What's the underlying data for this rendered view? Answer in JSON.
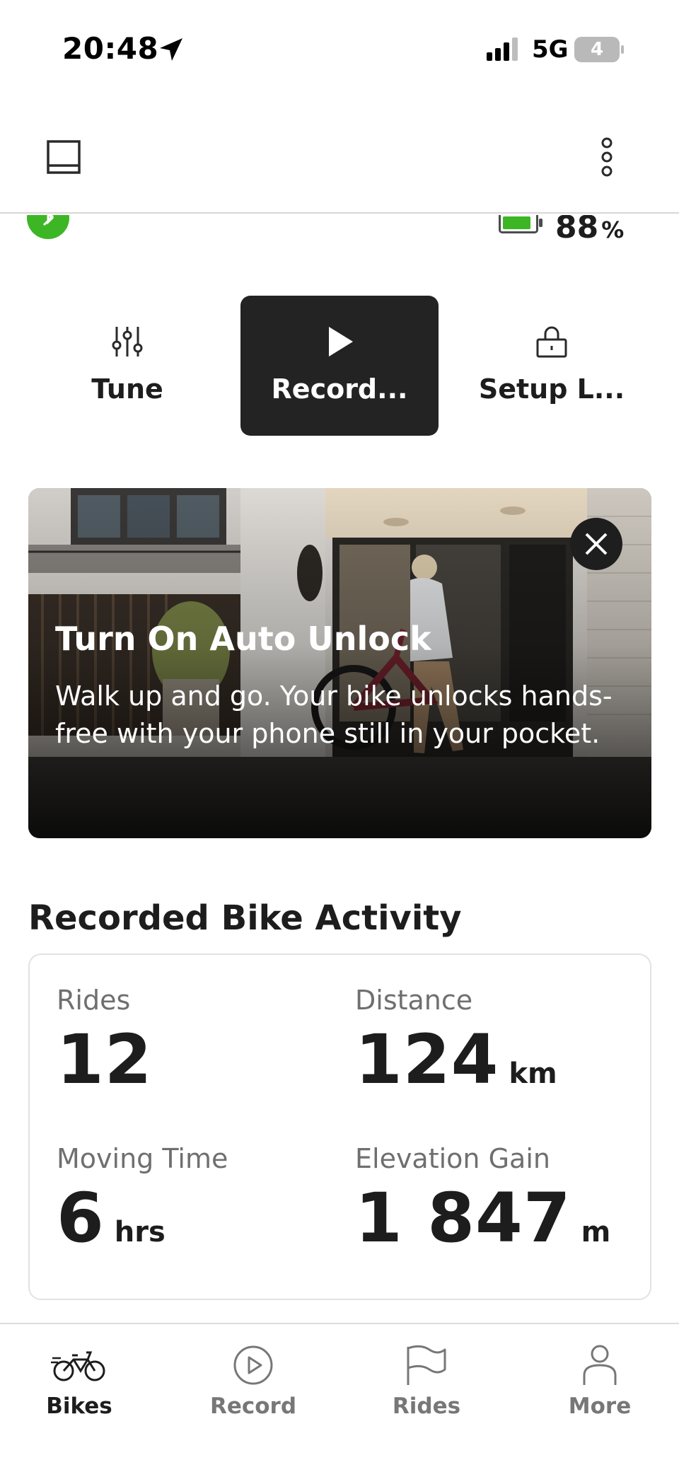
{
  "status_bar": {
    "time": "20:48",
    "network": "5G",
    "battery_level": "4"
  },
  "header": {
    "sidebar_icon": "sidebar-icon",
    "menu_icon": "more-vertical-icon"
  },
  "bike_status": {
    "bluetooth_icon": "bluetooth-icon",
    "battery_percent": "88",
    "battery_unit": "%",
    "battery_fill": 0.88
  },
  "actions": [
    {
      "label": "Tune",
      "icon": "sliders-icon"
    },
    {
      "label": "Record...",
      "icon": "play-icon"
    },
    {
      "label": "Setup L...",
      "icon": "lock-icon"
    }
  ],
  "promo": {
    "title": "Turn On Auto Unlock",
    "body": "Walk up and go. Your bike unlocks hands-free with your phone still in your pocket."
  },
  "activity": {
    "title": "Recorded Bike Activity",
    "stats": {
      "rides": {
        "label": "Rides",
        "value": "12",
        "unit": ""
      },
      "distance": {
        "label": "Distance",
        "value": "124",
        "unit": "km"
      },
      "moving_time": {
        "label": "Moving Time",
        "value": "6",
        "unit": "hrs"
      },
      "elevation_gain": {
        "label": "Elevation Gain",
        "value": "1 847",
        "unit": "m"
      }
    }
  },
  "tabs": [
    {
      "label": "Bikes",
      "icon": "bike-icon",
      "active": true
    },
    {
      "label": "Record",
      "icon": "play-circle-icon",
      "active": false
    },
    {
      "label": "Rides",
      "icon": "flag-icon",
      "active": false
    },
    {
      "label": "More",
      "icon": "person-icon",
      "active": false
    }
  ],
  "colors": {
    "accent_green": "#3db626",
    "dark": "#232323",
    "muted_text": "#6f6f6f"
  }
}
